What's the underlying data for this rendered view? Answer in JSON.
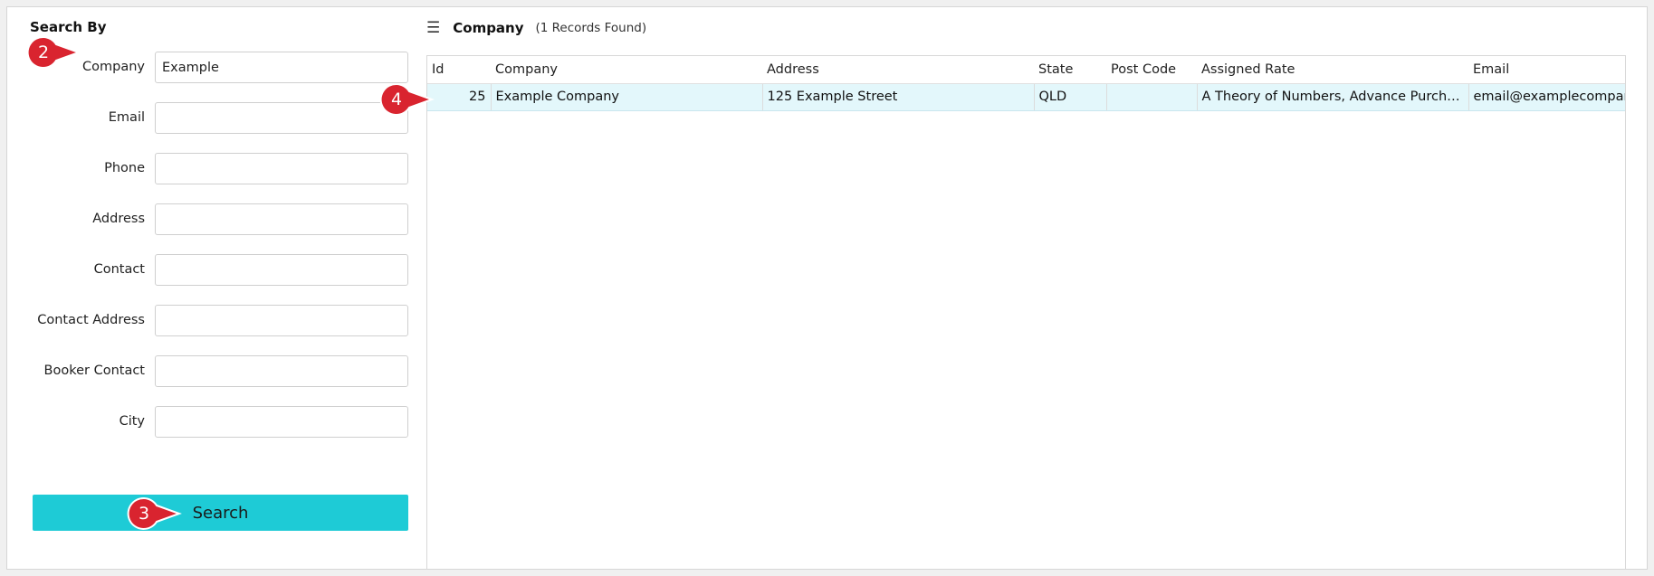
{
  "search_panel": {
    "title": "Search By",
    "fields": [
      {
        "label": "Company",
        "value": "Example",
        "placeholder": ""
      },
      {
        "label": "Email",
        "value": "",
        "placeholder": ""
      },
      {
        "label": "Phone",
        "value": "",
        "placeholder": ""
      },
      {
        "label": "Address",
        "value": "",
        "placeholder": ""
      },
      {
        "label": "Contact",
        "value": "",
        "placeholder": ""
      },
      {
        "label": "Contact Address",
        "value": "",
        "placeholder": ""
      },
      {
        "label": "Booker Contact",
        "value": "",
        "placeholder": ""
      },
      {
        "label": "City",
        "value": "",
        "placeholder": ""
      }
    ],
    "search_button": "Search"
  },
  "results": {
    "menu_icon": "hamburger-menu-icon",
    "title": "Company",
    "count_text": "(1 Records Found)",
    "columns": [
      "Id",
      "Company",
      "Address",
      "State",
      "Post Code",
      "Assigned Rate",
      "Email"
    ],
    "rows": [
      [
        "25",
        "Example Company",
        "125 Example Street",
        "QLD",
        "",
        "A Theory of Numbers, Advance Purchase, Best Available Rate",
        "email@examplecompany.com"
      ]
    ]
  },
  "callouts": [
    "2",
    "3",
    "4"
  ],
  "colors": {
    "accent": "#1ecbd6",
    "badge": "#d9242f",
    "row_highlight": "#e3f7fb"
  }
}
